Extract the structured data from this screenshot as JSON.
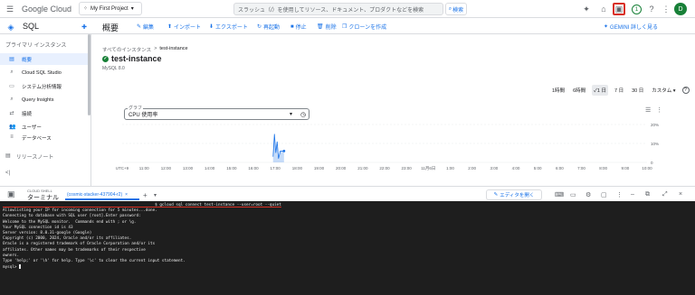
{
  "topbar": {
    "logo": "Google Cloud",
    "project": "My First Project",
    "search_placeholder": "スラッシュ（/）を使用してリソース、ドキュメント、プロダクトなどを検索",
    "search_button": "検索",
    "notification_count": "1",
    "avatar_initial": "D"
  },
  "subbar": {
    "product": "SQL",
    "page_title": "概要",
    "actions": [
      "編集",
      "インポート",
      "エクスポート",
      "再起動",
      "停止",
      "削除",
      "クローンを作成"
    ],
    "learn_more": "GEMINI 詳しく見る"
  },
  "sidebar": {
    "heading": "プライマリ インスタンス",
    "items": [
      "概要",
      "Cloud SQL Studio",
      "システム分析情報",
      "Query Insights",
      "接続",
      "ユーザー",
      "データベース"
    ],
    "footer": "リリースノート",
    "collapse": "<|"
  },
  "main": {
    "breadcrumb_root": "すべてのインスタンス",
    "breadcrumb_sep": ">",
    "breadcrumb_current": "test-instance",
    "instance_name": "test-instance",
    "db_version": "MySQL 8.0",
    "ranges": [
      "1時間",
      "6時間",
      "1 日",
      "7 日",
      "30 日",
      "カスタム"
    ],
    "selected_range": "1 日",
    "graph_legend": "グラフ",
    "graph_selected": "CPU 使用率"
  },
  "chart_data": {
    "type": "line",
    "x": [
      "UTC+9",
      "11:00",
      "12:00",
      "13:00",
      "14:00",
      "15:00",
      "16:00",
      "17:00",
      "18:00",
      "19:00",
      "20:00",
      "21:00",
      "22:00",
      "23:00",
      "11月6日",
      "1:00",
      "2:00",
      "3:00",
      "4:00",
      "5:00",
      "6:00",
      "7:00",
      "8:00",
      "9:00",
      "10:00"
    ],
    "y_ticks": [
      "20%",
      "10%",
      "0"
    ],
    "ylim": [
      0,
      20
    ],
    "series_values": [
      0,
      0,
      0,
      0,
      0,
      0,
      0,
      15,
      6,
      0,
      0,
      0,
      0,
      0,
      0,
      0,
      0,
      0,
      0,
      0,
      0,
      0,
      0,
      0,
      0
    ],
    "spike_x_index": [
      6.9,
      7.4
    ],
    "area_color": "#1a73e8"
  },
  "shell": {
    "label_small": "CLOUD SHELL",
    "label": "ターミナル",
    "tab_label": "(cosmic-stacker-437904-r2)",
    "editor_button": "エディタを開く",
    "lines": [
      "                                                                 $ gcloud sql connect test-instance --user=root --quiet",
      "Allowlisting your IP for incoming connection for 5 minutes...done.",
      "Connecting to database with SQL user [root].Enter password:",
      "Welcome to the MySQL monitor.  Commands end with ; or \\g.",
      "Your MySQL connection id is 43",
      "Server version: 8.0.31-google (Google)",
      "",
      "Copyright (c) 2000, 2024, Oracle and/or its affiliates.",
      "",
      "Oracle is a registered trademark of Oracle Corporation and/or its",
      "affiliates. Other names may be trademarks of their respective",
      "owners.",
      "",
      "Type 'help;' or '\\h' for help. Type '\\c' to clear the current input statement.",
      "",
      "mysql> "
    ]
  }
}
